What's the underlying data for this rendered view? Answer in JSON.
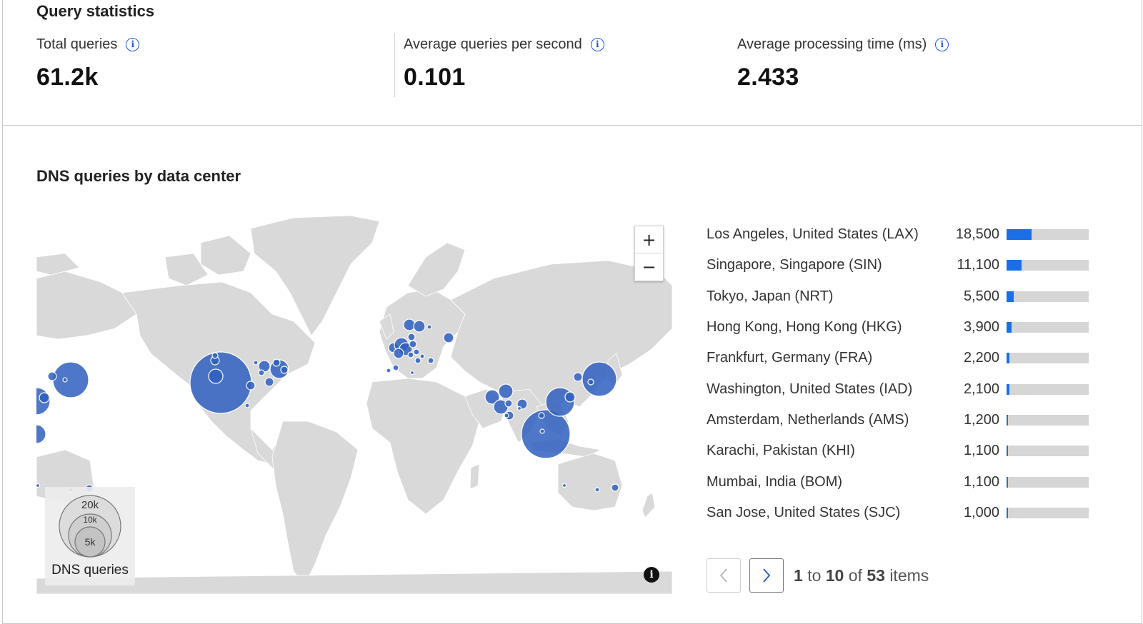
{
  "stats": {
    "title": "Query statistics",
    "items": [
      {
        "label": "Total queries",
        "value": "61.2k"
      },
      {
        "label": "Average queries per second",
        "value": "0.101"
      },
      {
        "label": "Average processing time (ms)",
        "value": "2.433"
      }
    ],
    "info_icon": "i"
  },
  "map": {
    "title": "DNS queries by data center",
    "zoom_in": "+",
    "zoom_out": "−",
    "legend_caption": "DNS queries",
    "legend_sizes": [
      "20k",
      "10k",
      "5k"
    ],
    "info_symbol": "i",
    "bubble_color": "#2f5fbf",
    "land_color": "#d9d9d9"
  },
  "ranking": [
    {
      "name": "Los Angeles, United States (LAX)",
      "value": "18,500",
      "share": 0.302
    },
    {
      "name": "Singapore, Singapore (SIN)",
      "value": "11,100",
      "share": 0.181
    },
    {
      "name": "Tokyo, Japan (NRT)",
      "value": "5,500",
      "share": 0.09
    },
    {
      "name": "Hong Kong, Hong Kong (HKG)",
      "value": "3,900",
      "share": 0.064
    },
    {
      "name": "Frankfurt, Germany (FRA)",
      "value": "2,200",
      "share": 0.036
    },
    {
      "name": "Washington, United States (IAD)",
      "value": "2,100",
      "share": 0.034
    },
    {
      "name": "Amsterdam, Netherlands (AMS)",
      "value": "1,200",
      "share": 0.02
    },
    {
      "name": "Karachi, Pakistan (KHI)",
      "value": "1,100",
      "share": 0.018
    },
    {
      "name": "Mumbai, India (BOM)",
      "value": "1,100",
      "share": 0.018
    },
    {
      "name": "San Jose, United States (SJC)",
      "value": "1,000",
      "share": 0.016
    }
  ],
  "pager": {
    "range_start": "1",
    "range_end": "10",
    "total": "53",
    "to_word": "to",
    "of_word": "of",
    "items_word": "items"
  }
}
